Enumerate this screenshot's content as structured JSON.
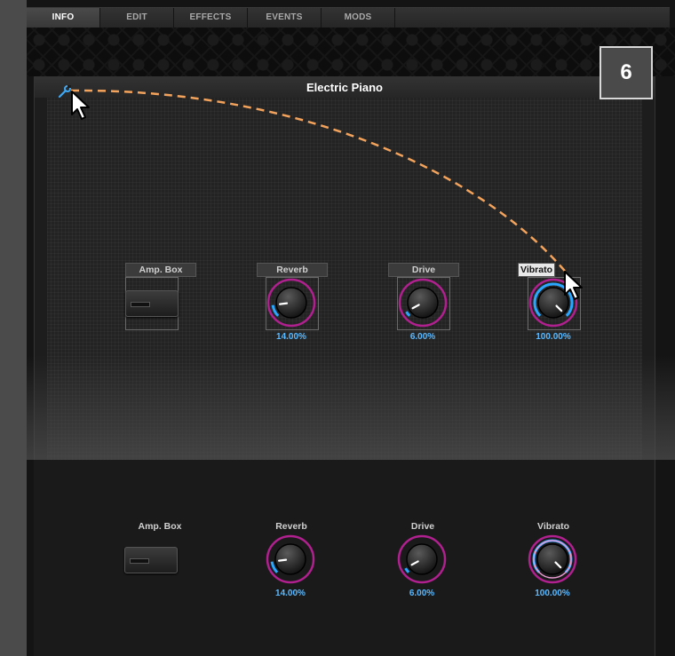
{
  "tabs": [
    {
      "label": "INFO",
      "active": true
    },
    {
      "label": "EDIT",
      "active": false
    },
    {
      "label": "EFFECTS",
      "active": false
    },
    {
      "label": "EVENTS",
      "active": false
    },
    {
      "label": "MODS",
      "active": false
    }
  ],
  "panel": {
    "title": "Electric Piano",
    "settings_icon": "wrench-icon"
  },
  "step_badge": "6",
  "controls_top": {
    "amp_box": {
      "label": "Amp. Box"
    },
    "reverb": {
      "label": "Reverb",
      "value": "14.00%",
      "level": 0.14
    },
    "drive": {
      "label": "Drive",
      "value": "6.00%",
      "level": 0.06
    },
    "vibrato": {
      "label": "Vibrato",
      "value": "100.00%",
      "level": 1.0
    }
  },
  "controls_bottom": {
    "amp_box": {
      "label": "Amp. Box"
    },
    "reverb": {
      "label": "Reverb",
      "value": "14.00%",
      "level": 0.14
    },
    "drive": {
      "label": "Drive",
      "value": "6.00%",
      "level": 0.06
    },
    "vibrato": {
      "label": "Vibrato",
      "value": "100.00%",
      "level": 1.0
    }
  },
  "colors": {
    "accent_blue": "#2aa6ff",
    "ring_magenta": "#b0208f",
    "drag_path": "#f3a35c"
  }
}
